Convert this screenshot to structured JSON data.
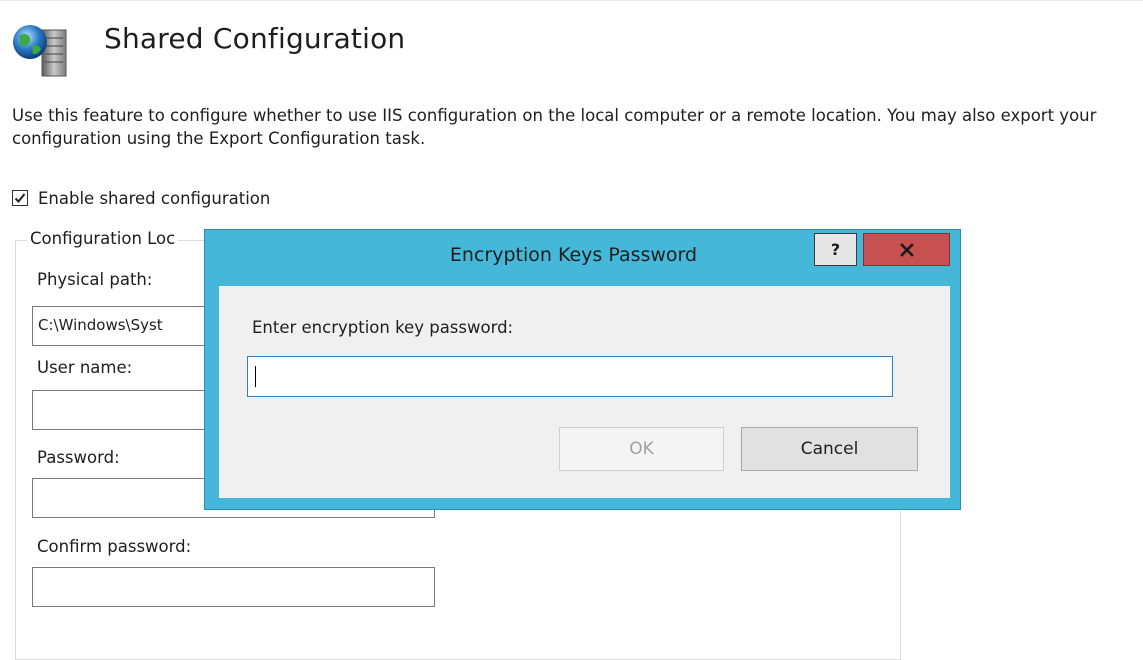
{
  "header": {
    "title": "Shared Configuration",
    "icon": "iis-server-globe-icon"
  },
  "description": "Use this feature to configure whether to use IIS configuration on the local computer or a remote location. You may also export your configuration using the Export Configuration task.",
  "enable_shared": {
    "label": "Enable shared configuration",
    "checked": true
  },
  "location_group": {
    "legend": "Configuration Loc",
    "physical_path": {
      "label": "Physical path:",
      "value": "C:\\Windows\\Syst"
    },
    "user_name": {
      "label": "User name:",
      "value": ""
    },
    "password": {
      "label": "Password:",
      "value": ""
    },
    "confirm_password": {
      "label": "Confirm password:",
      "value": ""
    }
  },
  "dialog": {
    "title": "Encryption Keys Password",
    "help_label": "?",
    "prompt": "Enter encryption key password:",
    "password_value": "",
    "ok_label": "OK",
    "ok_enabled": false,
    "cancel_label": "Cancel",
    "colors": {
      "frame": "#45b7d8",
      "close": "#c75050",
      "client": "#f0f0f0"
    }
  }
}
